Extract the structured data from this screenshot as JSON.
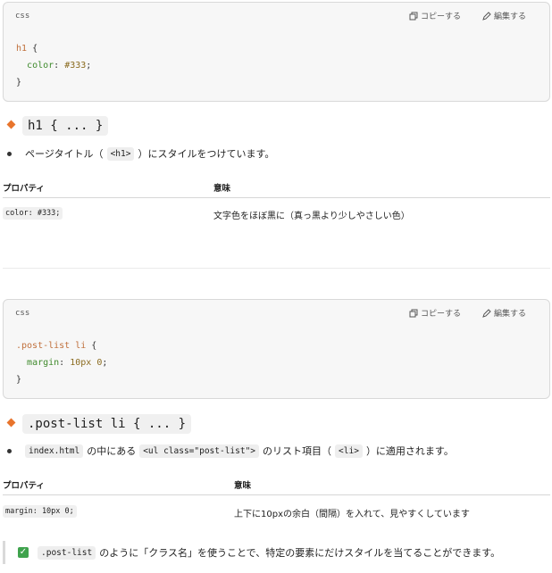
{
  "block1": {
    "lang": "css",
    "copy_label": "コピーする",
    "edit_label": "編集する",
    "code": {
      "selector": "h1",
      "open": " {",
      "prop": "color",
      "value": "#333",
      "close": "}"
    }
  },
  "section1": {
    "heading": "h1 { ... }",
    "bullet_pre": "ページタイトル（",
    "bullet_code": "<h1>",
    "bullet_post": "）にスタイルをつけています。",
    "table": {
      "col1": "プロパティ",
      "col2": "意味",
      "row_code": "color: #333;",
      "row_meaning": "文字色をほぼ黒に（真っ黒より少しやさしい色）"
    }
  },
  "block2": {
    "lang": "css",
    "copy_label": "コピーする",
    "edit_label": "編集する",
    "code": {
      "selector": ".post-list li",
      "open": " {",
      "prop": "margin",
      "value": "10px 0",
      "close": "}"
    }
  },
  "section2": {
    "heading": ".post-list li { ... }",
    "bullet_code1": "index.html",
    "bullet_mid1": "の中にある",
    "bullet_code2": "<ul class=\"post-list\">",
    "bullet_mid2": "のリスト項目（",
    "bullet_code3": "<li>",
    "bullet_post": "）に適用されます。",
    "table": {
      "col1": "プロパティ",
      "col2": "意味",
      "row_code": "margin: 10px 0;",
      "row_meaning": "上下に10pxの余白（間隔）を入れて、見やすくしています"
    }
  },
  "note": {
    "check": "✓",
    "code": ".post-list",
    "text": "のように「クラス名」を使うことで、特定の要素にだけスタイルを当てることができます。"
  },
  "colors": {
    "accent": "#e8742c",
    "check": "#3fa34d"
  }
}
